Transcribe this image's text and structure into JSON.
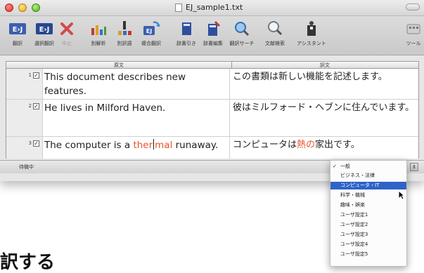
{
  "window": {
    "title": "EJ_sample1.txt"
  },
  "toolbar": {
    "items": [
      {
        "label": "翻訳",
        "icon": "translate-icon",
        "dim": false
      },
      {
        "label": "選択翻訳",
        "icon": "selected-translate-icon",
        "dim": false
      },
      {
        "label": "中止",
        "icon": "stop-icon",
        "dim": true
      },
      {
        "label": "別解析",
        "icon": "alt-parse-icon",
        "dim": false
      },
      {
        "label": "別訳語",
        "icon": "alt-word-icon",
        "dim": false
      },
      {
        "label": "複合翻訳",
        "icon": "compound-translate-icon",
        "dim": false
      },
      {
        "label": "辞書引き",
        "icon": "dictionary-lookup-icon",
        "dim": false
      },
      {
        "label": "辞書編集",
        "icon": "dictionary-edit-icon",
        "dim": false
      },
      {
        "label": "翻訳サーチ",
        "icon": "translate-search-icon",
        "dim": false
      },
      {
        "label": "文献検索",
        "icon": "literature-search-icon",
        "dim": false
      },
      {
        "label": "アシスタント",
        "icon": "assistant-icon",
        "dim": false
      },
      {
        "label": "ツール",
        "icon": "tool-icon",
        "dim": false
      }
    ]
  },
  "table": {
    "source_header": "原文",
    "target_header": "訳文",
    "rows": [
      {
        "num": "1",
        "checked": "✓",
        "source": "This document describes new features.",
        "target": "この書類は新しい機能を記述します。"
      },
      {
        "num": "2",
        "checked": "✓",
        "source": "He lives in Milford Haven.",
        "target": "彼はミルフォード・ヘブンに住んでいます。"
      },
      {
        "num": "3",
        "checked": "✓",
        "source_pre": "The computer is a ",
        "source_hl1": "ther",
        "source_hl2": "mal",
        "source_post": " runaway.",
        "target_pre": "コンピュータは",
        "target_hl": "熱の",
        "target_post": "家出です。"
      }
    ]
  },
  "status": {
    "text": "待機中"
  },
  "category_menu": {
    "items": [
      {
        "label": "一般",
        "checked": true,
        "selected": false
      },
      {
        "label": "ビジネス・法律",
        "checked": false,
        "selected": false
      },
      {
        "label": "コンピュータ・IT",
        "checked": false,
        "selected": true
      },
      {
        "label": "科学・機械",
        "checked": false,
        "selected": false
      },
      {
        "label": "趣味・娯楽",
        "checked": false,
        "selected": false
      },
      {
        "label": "ユーザ設定1",
        "checked": false,
        "selected": false
      },
      {
        "label": "ユーザ設定2",
        "checked": false,
        "selected": false
      },
      {
        "label": "ユーザ設定3",
        "checked": false,
        "selected": false
      },
      {
        "label": "ユーザ設定4",
        "checked": false,
        "selected": false
      },
      {
        "label": "ユーザ設定5",
        "checked": false,
        "selected": false
      }
    ]
  },
  "caption": {
    "text": "訳する"
  },
  "colors": {
    "highlight": "#e8522a",
    "menu_selection": "#2f63c8"
  }
}
